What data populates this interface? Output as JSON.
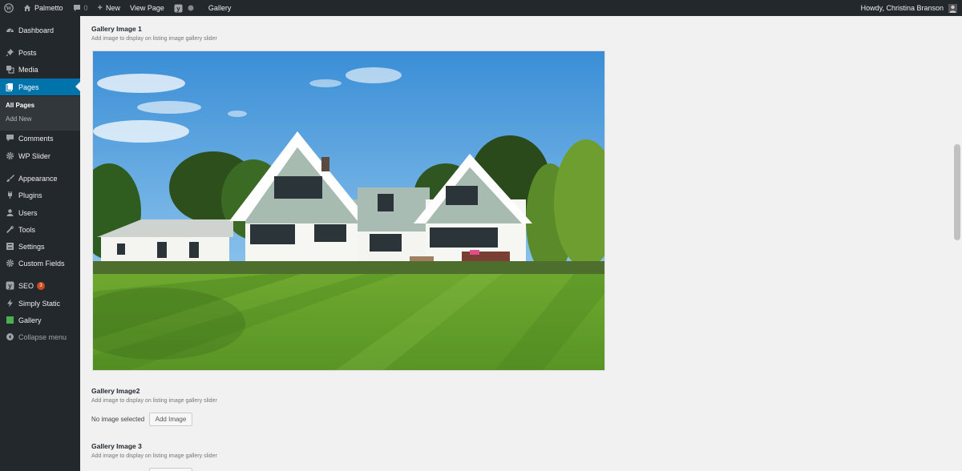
{
  "adminbar": {
    "site_name": "Palmetto",
    "comments_count": "0",
    "new_label": "New",
    "view_page_label": "View Page",
    "gallery_label": "Gallery",
    "howdy": "Howdy, Christina Branson"
  },
  "sidebar": {
    "items": [
      {
        "label": "Dashboard",
        "icon": "dashboard-icon"
      },
      {
        "label": "Posts",
        "icon": "pin-icon"
      },
      {
        "label": "Media",
        "icon": "media-icon"
      },
      {
        "label": "Pages",
        "icon": "pages-icon"
      },
      {
        "label": "Comments",
        "icon": "comment-icon"
      },
      {
        "label": "WP Slider",
        "icon": "gear-icon"
      },
      {
        "label": "Appearance",
        "icon": "brush-icon"
      },
      {
        "label": "Plugins",
        "icon": "plug-icon"
      },
      {
        "label": "Users",
        "icon": "user-icon"
      },
      {
        "label": "Tools",
        "icon": "wrench-icon"
      },
      {
        "label": "Settings",
        "icon": "settings-icon"
      },
      {
        "label": "Custom Fields",
        "icon": "gear-icon"
      },
      {
        "label": "SEO",
        "icon": "yoast-icon",
        "badge": "3"
      },
      {
        "label": "Simply Static",
        "icon": "bolt-icon"
      },
      {
        "label": "Gallery",
        "icon": "gallery-icon"
      },
      {
        "label": "Collapse menu",
        "icon": "collapse-icon"
      }
    ],
    "submenu": [
      "All Pages",
      "Add New"
    ]
  },
  "fields": [
    {
      "label": "Gallery Image 1",
      "description": "Add image to display on listing image gallery slider"
    },
    {
      "label": "Gallery Image2",
      "description": "Add image to display on listing image gallery slider",
      "status": "No image selected",
      "button": "Add Image"
    },
    {
      "label": "Gallery Image 3",
      "description": "Add image to display on listing image gallery slider"
    }
  ],
  "colors": {
    "adminbar_bg": "#23282d",
    "sidebar_bg": "#23282d",
    "active_menu": "#0073aa",
    "badge": "#ca4a1f",
    "content_bg": "#f1f1f1"
  }
}
